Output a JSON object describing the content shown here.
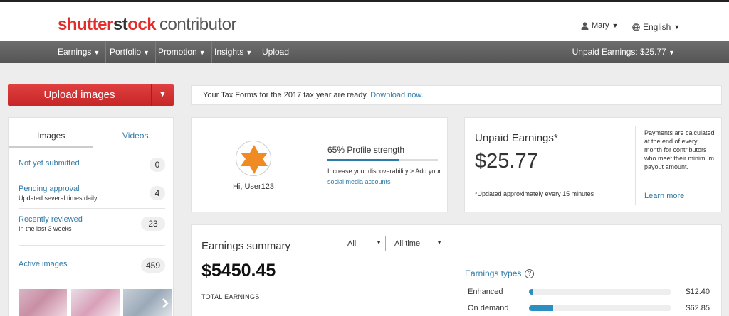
{
  "header": {
    "logo_brand": "shutterstock",
    "logo_sub": "contributor",
    "user_name": "Mary",
    "language": "English"
  },
  "nav": {
    "items": [
      {
        "label": "Earnings",
        "has_dropdown": true
      },
      {
        "label": "Portfolio",
        "has_dropdown": true
      },
      {
        "label": "Promotion",
        "has_dropdown": true
      },
      {
        "label": "Insights",
        "has_dropdown": true
      },
      {
        "label": "Upload",
        "has_dropdown": false
      }
    ],
    "unpaid_earnings": "Unpaid Earnings: $25.77"
  },
  "upload_button": {
    "label": "Upload images"
  },
  "tax_banner": {
    "text": "Your Tax Forms for the 2017 tax year are ready.",
    "link": "Download now."
  },
  "sidebar": {
    "tabs": [
      {
        "label": "Images",
        "active": true
      },
      {
        "label": "Videos",
        "active": false
      }
    ],
    "items": [
      {
        "label": "Not yet submitted",
        "sub": "",
        "count": "0"
      },
      {
        "label": "Pending approval",
        "sub": "Updated several times daily",
        "count": "4"
      },
      {
        "label": "Recently reviewed",
        "sub": "In the last 3 weeks",
        "count": "23"
      },
      {
        "label": "Active images",
        "sub": "",
        "count": "459"
      }
    ]
  },
  "profile": {
    "greeting": "Hi, User123",
    "strength_label": "65% Profile strength",
    "strength_pct": 65,
    "desc_text": "Increase your discoverability > Add your",
    "desc_link": "social media accounts"
  },
  "unpaid_card": {
    "title": "Unpaid Earnings*",
    "amount": "$25.77",
    "updated_note": "*Updated approximately every 15 minutes",
    "payment_note": "Payments are calculated at the end of every month for contributors who meet their minimum payout amount.",
    "learn_more": "Learn more"
  },
  "earnings_summary": {
    "title": "Earnings summary",
    "filter_type": "All",
    "filter_period": "All time",
    "total": "$5450.45",
    "total_label": "TOTAL EARNINGS",
    "types_title": "Earnings types",
    "types": [
      {
        "label": "Enhanced",
        "value": "$12.40",
        "fraction": 0.03
      },
      {
        "label": "On demand",
        "value": "$62.85",
        "fraction": 0.17
      }
    ]
  },
  "colors": {
    "brand_red": "#e32d2d",
    "link_blue": "#2f7ba8",
    "nav_gray": "#5f5f5f",
    "avatar_orange": "#f08a23"
  }
}
